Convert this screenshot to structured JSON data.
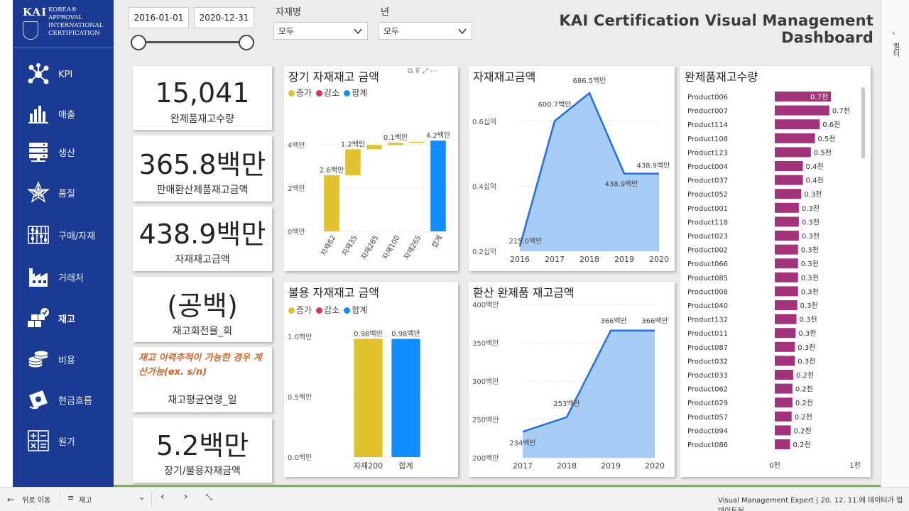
{
  "sidebar": {
    "logo_kai": "KAI",
    "logo_lines": [
      "KOREA®",
      "APPROVAL",
      "INTERNATIONAL",
      "CERTIFICATION"
    ],
    "items": [
      {
        "label": "KPI",
        "icon": "network-icon"
      },
      {
        "label": "매출",
        "icon": "bar-chart-icon"
      },
      {
        "label": "생산",
        "icon": "server-stack-icon"
      },
      {
        "label": "품질",
        "icon": "star-web-icon"
      },
      {
        "label": "구매/자재",
        "icon": "abacus-icon"
      },
      {
        "label": "거래처",
        "icon": "factory-icon"
      },
      {
        "label": "재고",
        "icon": "boxes-check-icon"
      },
      {
        "label": "비용",
        "icon": "coins-icon"
      },
      {
        "label": "현금흐름",
        "icon": "cash-icon"
      },
      {
        "label": "원가",
        "icon": "calculator-icon"
      }
    ],
    "active_index": 6
  },
  "filters": {
    "date_start": "2016-01-01",
    "date_end": "2020-12-31",
    "material_label": "자재명",
    "material_value": "모두",
    "year_label": "년",
    "year_value": "모두"
  },
  "title": "KAI Certification Visual Management Dashboard",
  "kpis": [
    {
      "value": "15,041",
      "label": "완제품재고수량"
    },
    {
      "value": "365.8백만",
      "label": "판매환산제품재고금액"
    },
    {
      "value": "438.9백만",
      "label": "자재재고금액"
    },
    {
      "value": "(공백)",
      "label": "재고회전율_회"
    },
    {
      "note": "재고 이력추적이 가능한 경우 계산가능(ex. s/n)",
      "label": "재고평균연령_일"
    },
    {
      "value": "5.2백만",
      "label": "장기/불용자재금액"
    }
  ],
  "waterfall_legend": [
    "증가",
    "감소",
    "합계"
  ],
  "colors": {
    "increase": "#e0c22e",
    "decrease": "#d9374f",
    "total": "#118dff",
    "area_fill": "#a7cdf7",
    "area_line": "#1f6fe8",
    "hbar": "#a3337a",
    "nav_bg": "#1a3a93"
  },
  "charts": {
    "long_term": {
      "title": "장기 자재재고 금액",
      "type": "waterfall",
      "categories": [
        "자재62",
        "자재35",
        "자재285",
        "자재100",
        "자재265",
        "합계"
      ],
      "values": [
        2.6,
        1.2,
        0.2,
        0.1,
        0.05,
        4.2
      ],
      "labels": [
        "2.6백만",
        "1.2백만",
        "",
        "0.1백만",
        "",
        "4.2백만"
      ],
      "y_ticks": [
        "0백만",
        "2백만",
        "4백만"
      ],
      "ylim": [
        0,
        4.6
      ]
    },
    "dead_stock": {
      "title": "불용 자재재고 금액",
      "type": "waterfall",
      "categories": [
        "자재200",
        "합계"
      ],
      "values": [
        0.98,
        0.98
      ],
      "labels": [
        "0.98백만",
        "0.98백만"
      ],
      "y_ticks": [
        "0.0백만",
        "0.5백만",
        "1.0백만"
      ],
      "ylim": [
        0,
        1.0
      ]
    },
    "material_stock": {
      "title": "자재재고금액",
      "type": "area",
      "x": [
        "2016",
        "2017",
        "2018",
        "2019",
        "2020"
      ],
      "values": [
        215.0,
        600.7,
        686.5,
        438.9,
        438.9
      ],
      "labels": [
        "215.0백만",
        "600.7백만",
        "686.5백만",
        "438.9백만",
        "438.9백만"
      ],
      "y_ticks": [
        "0.2십억",
        "0.4십억",
        "0.6십억"
      ],
      "ylim": [
        200,
        700
      ]
    },
    "converted_stock": {
      "title": "환산 완제품 재고금액",
      "type": "area",
      "x": [
        "2017",
        "2018",
        "2019",
        "2020"
      ],
      "values": [
        234,
        253,
        366,
        366
      ],
      "labels": [
        "234백만",
        "253백만",
        "366백만",
        "366백만"
      ],
      "y_ticks": [
        "200백만",
        "250백만",
        "300백만",
        "350백만",
        "400백만"
      ],
      "ylim": [
        200,
        400
      ]
    },
    "finished_qty": {
      "title": "완제품재고수량",
      "type": "bar",
      "categories": [
        "Product006",
        "Product007",
        "Product114",
        "Product108",
        "Product123",
        "Product004",
        "Product037",
        "Product052",
        "Product001",
        "Product118",
        "Product023",
        "Product002",
        "Product066",
        "Product085",
        "Product008",
        "Product040",
        "Product132",
        "Product011",
        "Product087",
        "Product032",
        "Product033",
        "Product062",
        "Product029",
        "Product057",
        "Product094",
        "Product086"
      ],
      "values": [
        0.7,
        0.68,
        0.56,
        0.5,
        0.45,
        0.35,
        0.35,
        0.33,
        0.3,
        0.3,
        0.3,
        0.29,
        0.29,
        0.29,
        0.29,
        0.28,
        0.27,
        0.26,
        0.25,
        0.25,
        0.23,
        0.22,
        0.22,
        0.21,
        0.2,
        0.19
      ],
      "labels": [
        "0.7천",
        "0.7천",
        "0.6천",
        "0.5천",
        "0.5천",
        "0.4천",
        "0.4천",
        "0.3천",
        "0.3천",
        "0.3천",
        "0.3천",
        "0.3천",
        "0.3천",
        "0.3천",
        "0.3천",
        "0.3천",
        "0.3천",
        "0.3천",
        "0.3천",
        "0.3천",
        "0.2천",
        "0.2천",
        "0.2천",
        "0.2천",
        "0.2천",
        "0.2천"
      ],
      "x_ticks": [
        "0천",
        "1천"
      ],
      "xlim": [
        0,
        1
      ]
    }
  },
  "bottombar": {
    "back": "뒤로 이동",
    "page": "재고",
    "status": "Visual Management Expert  |  20. 12. 11.에 데이터가 업데이트됨"
  },
  "right_pane_label": "필터"
}
